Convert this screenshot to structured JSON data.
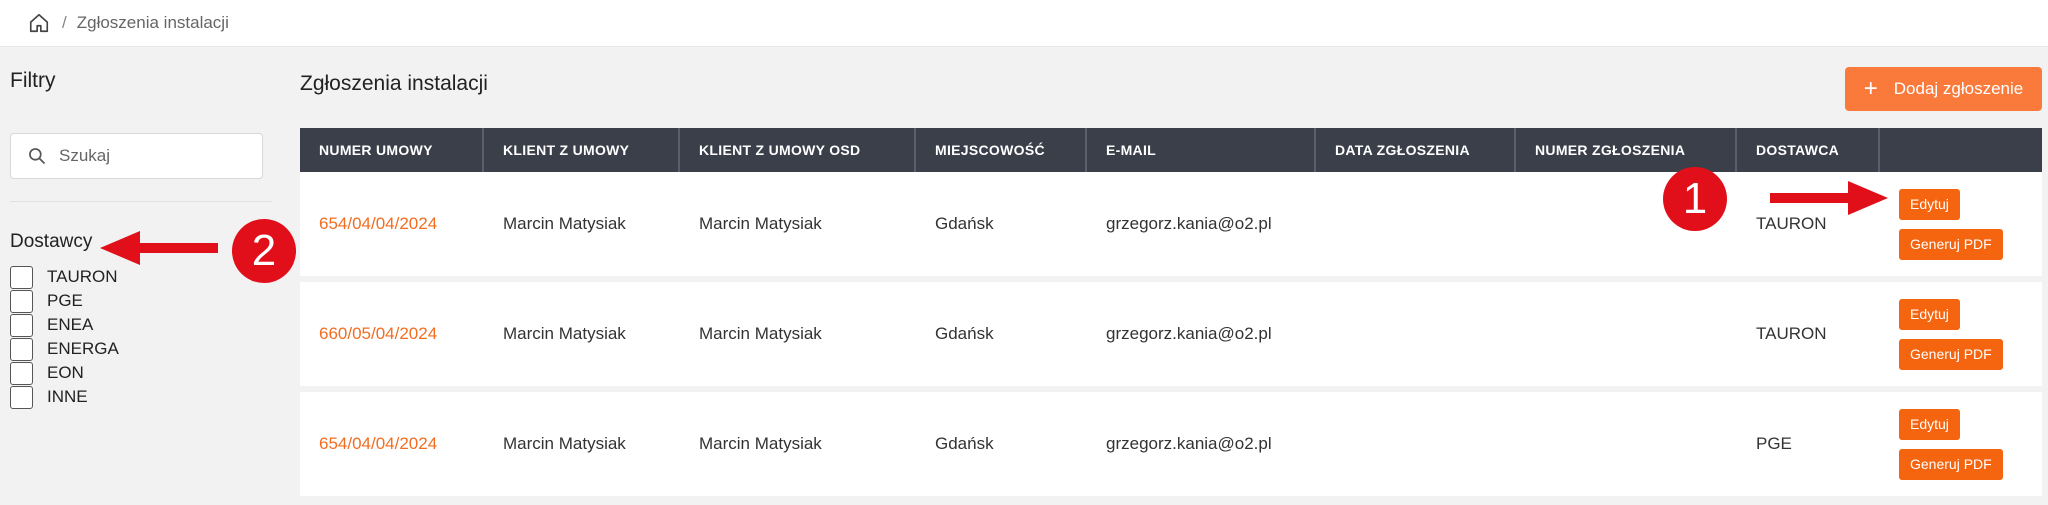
{
  "breadcrumb": {
    "separator": "/",
    "current": "Zgłoszenia instalacji"
  },
  "sidebar": {
    "title": "Filtry",
    "search_placeholder": "Szukaj",
    "suppliers_title": "Dostawcy",
    "suppliers": [
      "TAURON",
      "PGE",
      "ENEA",
      "ENERGA",
      "EON",
      "INNE"
    ]
  },
  "main": {
    "title": "Zgłoszenia instalacji",
    "add_button": "Dodaj zgłoszenie",
    "columns": [
      "NUMER UMOWY",
      "KLIENT Z UMOWY",
      "KLIENT Z UMOWY OSD",
      "MIEJSCOWOŚĆ",
      "E-MAIL",
      "DATA ZGŁOSZENIA",
      "NUMER ZGŁOSZENIA",
      "DOSTAWCA",
      ""
    ],
    "rows": [
      {
        "numer": "654/04/04/2024",
        "klient": "Marcin Matysiak",
        "klient_osd": "Marcin Matysiak",
        "miejscowosc": "Gdańsk",
        "email": "grzegorz.kania@o2.pl",
        "data": "",
        "numer_zgl": "",
        "dostawca": "TAURON",
        "edit": "Edytuj",
        "pdf": "Generuj PDF"
      },
      {
        "numer": "660/05/04/2024",
        "klient": "Marcin Matysiak",
        "klient_osd": "Marcin Matysiak",
        "miejscowosc": "Gdańsk",
        "email": "grzegorz.kania@o2.pl",
        "data": "",
        "numer_zgl": "",
        "dostawca": "TAURON",
        "edit": "Edytuj",
        "pdf": "Generuj PDF"
      },
      {
        "numer": "654/04/04/2024",
        "klient": "Marcin Matysiak",
        "klient_osd": "Marcin Matysiak",
        "miejscowosc": "Gdańsk",
        "email": "grzegorz.kania@o2.pl",
        "data": "",
        "numer_zgl": "",
        "dostawca": "PGE",
        "edit": "Edytuj",
        "pdf": "Generuj PDF"
      }
    ]
  },
  "annotations": {
    "badge_1": "1",
    "badge_2": "2"
  },
  "colors": {
    "accent": "#f5640e",
    "header_bg": "#3b3f4a",
    "annotation_red": "#e10f19"
  }
}
